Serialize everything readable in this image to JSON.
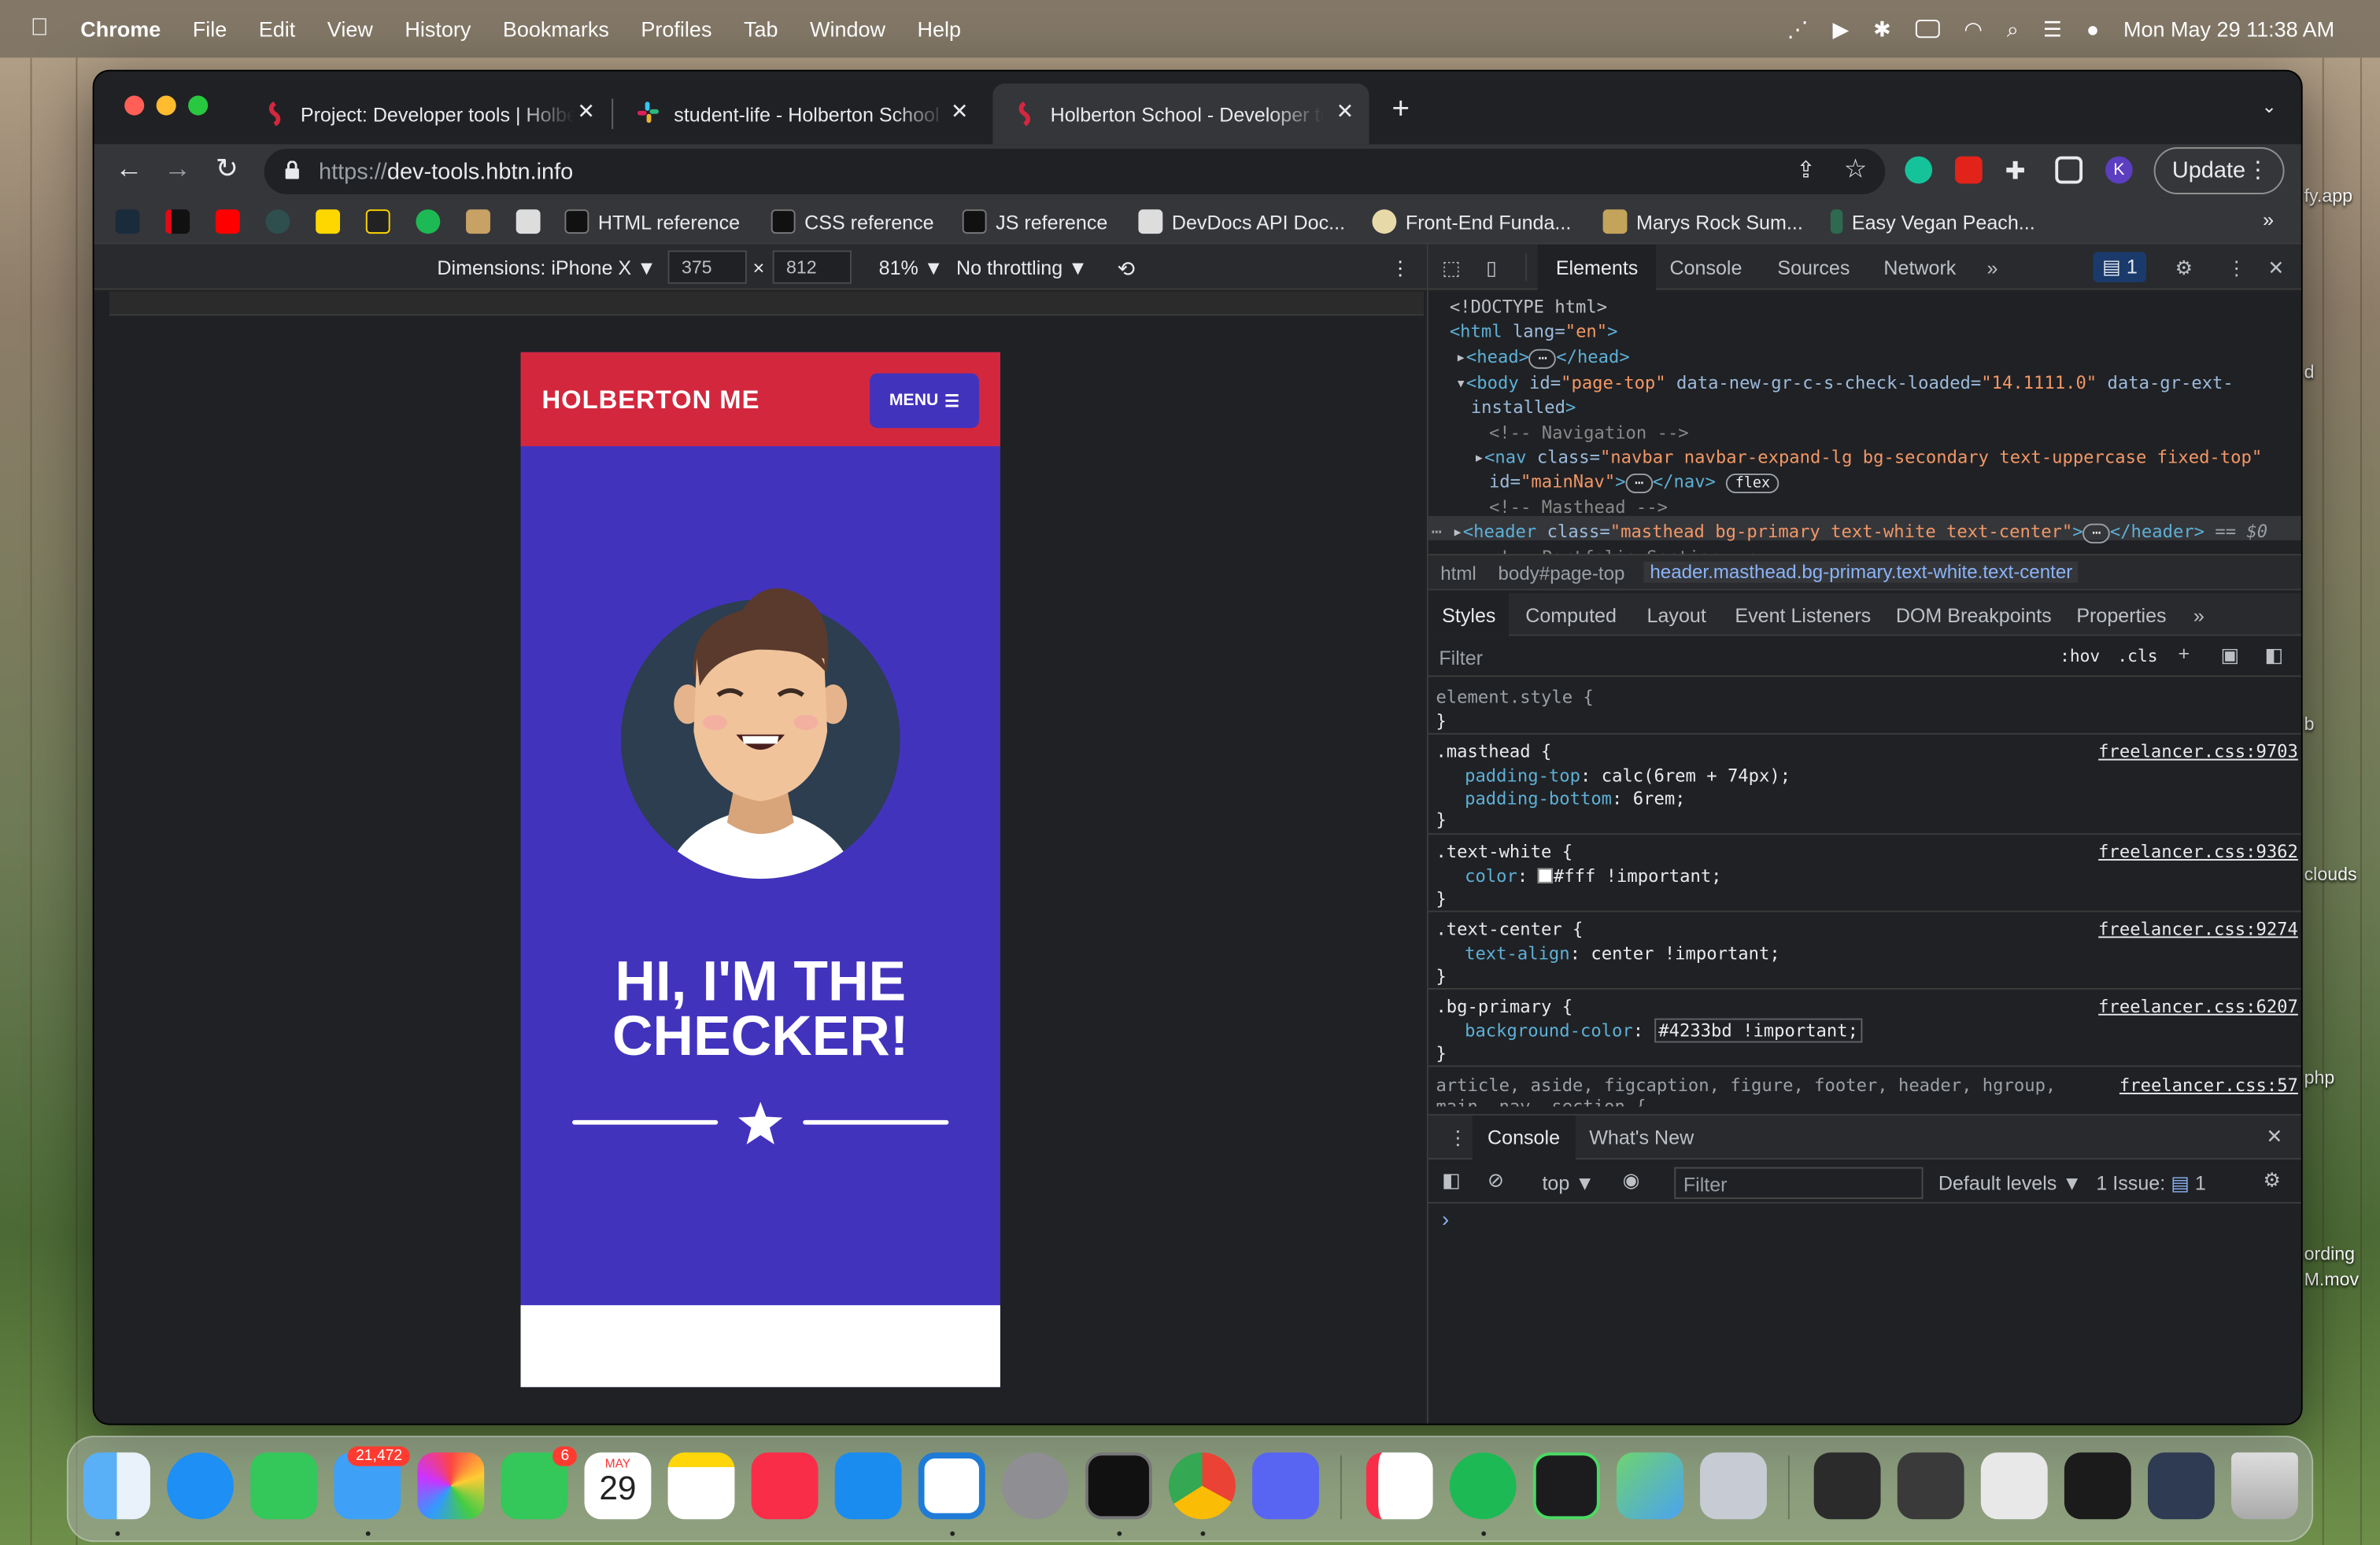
{
  "menubar": {
    "app": "Chrome",
    "items": [
      "File",
      "Edit",
      "View",
      "History",
      "Bookmarks",
      "Profiles",
      "Tab",
      "Window",
      "Help"
    ],
    "clock": "Mon May 29  11:38 AM"
  },
  "tabs": [
    {
      "title": "Project: Developer tools | Holberton",
      "active": false
    },
    {
      "title": "student-life - Holberton School",
      "active": false
    },
    {
      "title": "Holberton School - Developer tools",
      "active": true
    }
  ],
  "address": {
    "prefix": "https://",
    "host": "dev-tools.hbtn.info"
  },
  "update_label": "Update",
  "profile_initial": "K",
  "bookmarks": [
    {
      "label": "HTML reference"
    },
    {
      "label": "CSS reference"
    },
    {
      "label": "JS reference"
    },
    {
      "label": "DevDocs API Doc..."
    },
    {
      "label": "Front-End Funda..."
    },
    {
      "label": "Marys Rock Sum..."
    },
    {
      "label": "Easy Vegan Peach..."
    }
  ],
  "more_bookmarks": "»",
  "device_toolbar": {
    "dimensions": "Dimensions: iPhone X ▼",
    "width": "375",
    "height": "812",
    "times": "×",
    "zoom": "81% ▼",
    "throttling": "No throttling ▼"
  },
  "page": {
    "brand": "HOLBERTON ME",
    "menu": "MENU",
    "headline_1": "HI, I'M THE",
    "headline_2": "CHECKER!"
  },
  "devtools": {
    "tabs": [
      "Elements",
      "Console",
      "Sources",
      "Network"
    ],
    "more": "»",
    "issues_count": "1",
    "dom": {
      "doctype": "<!DOCTYPE html>",
      "html_open": "<html",
      "html_attr": " lang=",
      "html_val": "\"en\"",
      "html_close": ">",
      "head": "<head>",
      "head_close": "</head>",
      "ellipsis": "⋯",
      "body_tag": "<body",
      "body_attr1": " id=",
      "body_val1": "\"page-top\"",
      "body_attr2": " data-new-gr-c-s-check-loaded=",
      "body_val2": "\"14.1111.0\"",
      "body_attr3": " data-gr-ext-",
      "body_attr3b": "installed",
      "body_close": ">",
      "comment_nav": "<!-- Navigation -->",
      "nav_tag": "<nav",
      "nav_attr": " class=",
      "nav_val": "\"navbar navbar-expand-lg bg-secondary text-uppercase fixed-top\"",
      "nav_attr2": "id=",
      "nav_val2": "\"mainNav\"",
      "nav_gt": ">",
      "nav_close": "</nav>",
      "flex": "flex",
      "comment_masthead": "<!-- Masthead -->",
      "header_tag": "<header",
      "header_attr": " class=",
      "header_val": "\"masthead bg-primary text-white text-center\"",
      "header_gt": ">",
      "header_close": "</header>",
      "sel_marker": "== $0",
      "comment_portfolio": "<!-- Portfolio Section -->"
    },
    "breadcrumbs": [
      "html",
      "body#page-top",
      "header.masthead.bg-primary.text-white.text-center"
    ],
    "style_tabs": [
      "Styles",
      "Computed",
      "Layout",
      "Event Listeners",
      "DOM Breakpoints",
      "Properties"
    ],
    "filter_placeholder": "Filter",
    "hov": ":hov",
    "cls": ".cls",
    "rules": {
      "element_style": "element.style {",
      "close": "}",
      "masthead_sel": ".masthead {",
      "masthead_src": "freelancer.css:9703",
      "padding_top_prop": "padding-top",
      "padding_top_val": ": calc(6rem + 74px);",
      "padding_bottom_prop": "padding-bottom",
      "padding_bottom_val": ": 6rem;",
      "textwhite_sel": ".text-white {",
      "textwhite_src": "freelancer.css:9362",
      "color_prop": "color",
      "color_val": "#fff !important;",
      "textcenter_sel": ".text-center {",
      "textcenter_src": "freelancer.css:9274",
      "textalign_prop": "text-align",
      "textalign_val": ": center !important;",
      "bgprimary_sel": ".bg-primary {",
      "bgprimary_src": "freelancer.css:6207",
      "bgcolor_prop": "background-color",
      "bgcolor_val": "#4233bd !important;",
      "ua_sel": "article, aside, figcaption, figure, footer, header, hgroup,",
      "ua_sel2": "main, nav, section {",
      "ua_src": "freelancer.css:57"
    },
    "drawer_tabs": [
      "Console",
      "What's New"
    ],
    "console": {
      "context": "top ▼",
      "filter": "Filter",
      "levels": "Default levels ▼",
      "issues": "1 Issue:",
      "issues_count": "1",
      "prompt": "›"
    }
  },
  "dock": {
    "mail_badge": "21,472",
    "facetime_badge": "6",
    "cal_month": "MAY",
    "cal_day": "29"
  },
  "desktop_labels": {
    "a": "fy.app",
    "b": "clouds",
    "c": "php",
    "d": "ording",
    "e": "M.mov",
    "f": "d",
    "g": "b"
  },
  "colors": {
    "primary": "#4233bd",
    "secondary": "#d3273e",
    "chrome_bg": "#202124",
    "chrome_toolbar": "#35363a"
  }
}
